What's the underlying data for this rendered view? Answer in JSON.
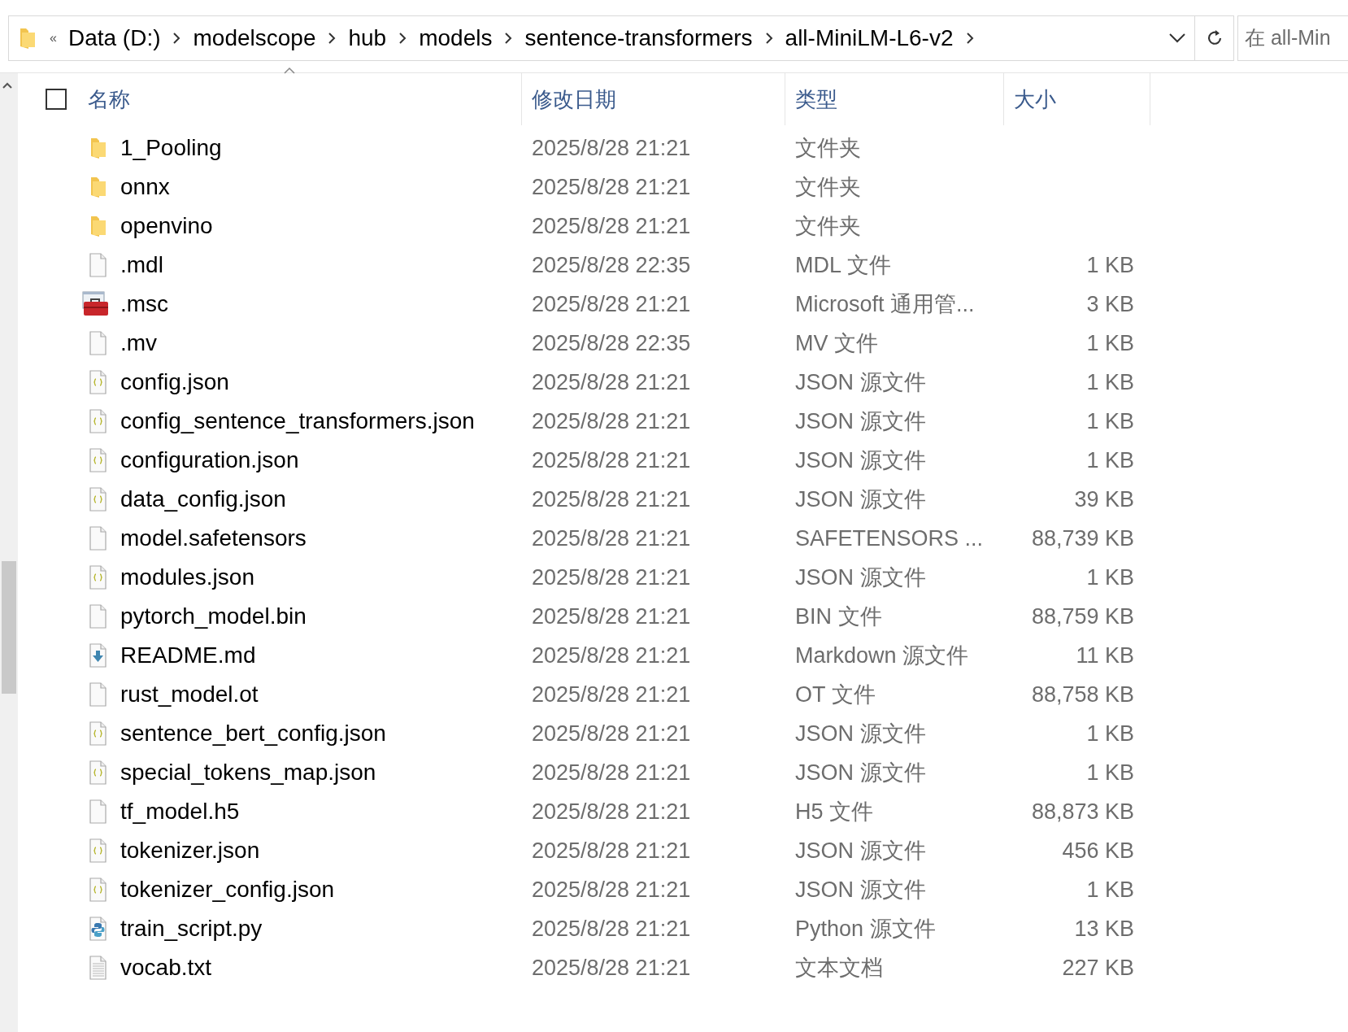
{
  "address_bar": {
    "overflow": "«",
    "crumbs": [
      "Data (D:)",
      "modelscope",
      "hub",
      "models",
      "sentence-transformers",
      "all-MiniLM-L6-v2"
    ]
  },
  "search": {
    "placeholder": "在 all-Min"
  },
  "columns": [
    "名称",
    "修改日期",
    "类型",
    "大小"
  ],
  "select_all": {
    "checked": false
  },
  "files": [
    {
      "kind": "folder",
      "name": "1_Pooling",
      "date": "2025/8/28 21:21",
      "type": "文件夹"
    },
    {
      "kind": "folder",
      "name": "onnx",
      "date": "2025/8/28 21:21",
      "type": "文件夹"
    },
    {
      "kind": "folder",
      "name": "openvino",
      "date": "2025/8/28 21:21",
      "type": "文件夹"
    },
    {
      "kind": "file",
      "name": ".mdl",
      "date": "2025/8/28 22:35",
      "type": "MDL 文件",
      "size": "1 KB"
    },
    {
      "kind": "msc",
      "name": ".msc",
      "date": "2025/8/28 21:21",
      "type": "Microsoft 通用管...",
      "size": "3 KB"
    },
    {
      "kind": "file",
      "name": ".mv",
      "date": "2025/8/28 22:35",
      "type": "MV 文件",
      "size": "1 KB"
    },
    {
      "kind": "json",
      "name": "config.json",
      "date": "2025/8/28 21:21",
      "type": "JSON 源文件",
      "size": "1 KB"
    },
    {
      "kind": "json",
      "name": "config_sentence_transformers.json",
      "date": "2025/8/28 21:21",
      "type": "JSON 源文件",
      "size": "1 KB"
    },
    {
      "kind": "json",
      "name": "configuration.json",
      "date": "2025/8/28 21:21",
      "type": "JSON 源文件",
      "size": "1 KB"
    },
    {
      "kind": "json",
      "name": "data_config.json",
      "date": "2025/8/28 21:21",
      "type": "JSON 源文件",
      "size": "39 KB"
    },
    {
      "kind": "file",
      "name": "model.safetensors",
      "date": "2025/8/28 21:21",
      "type": "SAFETENSORS ...",
      "size": "88,739 KB"
    },
    {
      "kind": "json",
      "name": "modules.json",
      "date": "2025/8/28 21:21",
      "type": "JSON 源文件",
      "size": "1 KB"
    },
    {
      "kind": "file",
      "name": "pytorch_model.bin",
      "date": "2025/8/28 21:21",
      "type": "BIN 文件",
      "size": "88,759 KB"
    },
    {
      "kind": "markdown",
      "name": "README.md",
      "date": "2025/8/28 21:21",
      "type": "Markdown 源文件",
      "size": "11 KB"
    },
    {
      "kind": "file",
      "name": "rust_model.ot",
      "date": "2025/8/28 21:21",
      "type": "OT 文件",
      "size": "88,758 KB"
    },
    {
      "kind": "json",
      "name": "sentence_bert_config.json",
      "date": "2025/8/28 21:21",
      "type": "JSON 源文件",
      "size": "1 KB"
    },
    {
      "kind": "json",
      "name": "special_tokens_map.json",
      "date": "2025/8/28 21:21",
      "type": "JSON 源文件",
      "size": "1 KB"
    },
    {
      "kind": "file",
      "name": "tf_model.h5",
      "date": "2025/8/28 21:21",
      "type": "H5 文件",
      "size": "88,873 KB"
    },
    {
      "kind": "json",
      "name": "tokenizer.json",
      "date": "2025/8/28 21:21",
      "type": "JSON 源文件",
      "size": "456 KB"
    },
    {
      "kind": "json",
      "name": "tokenizer_config.json",
      "date": "2025/8/28 21:21",
      "type": "JSON 源文件",
      "size": "1 KB"
    },
    {
      "kind": "python",
      "name": "train_script.py",
      "date": "2025/8/28 21:21",
      "type": "Python 源文件",
      "size": "13 KB"
    },
    {
      "kind": "text",
      "name": "vocab.txt",
      "date": "2025/8/28 21:21",
      "type": "文本文档",
      "size": "227 KB"
    }
  ]
}
